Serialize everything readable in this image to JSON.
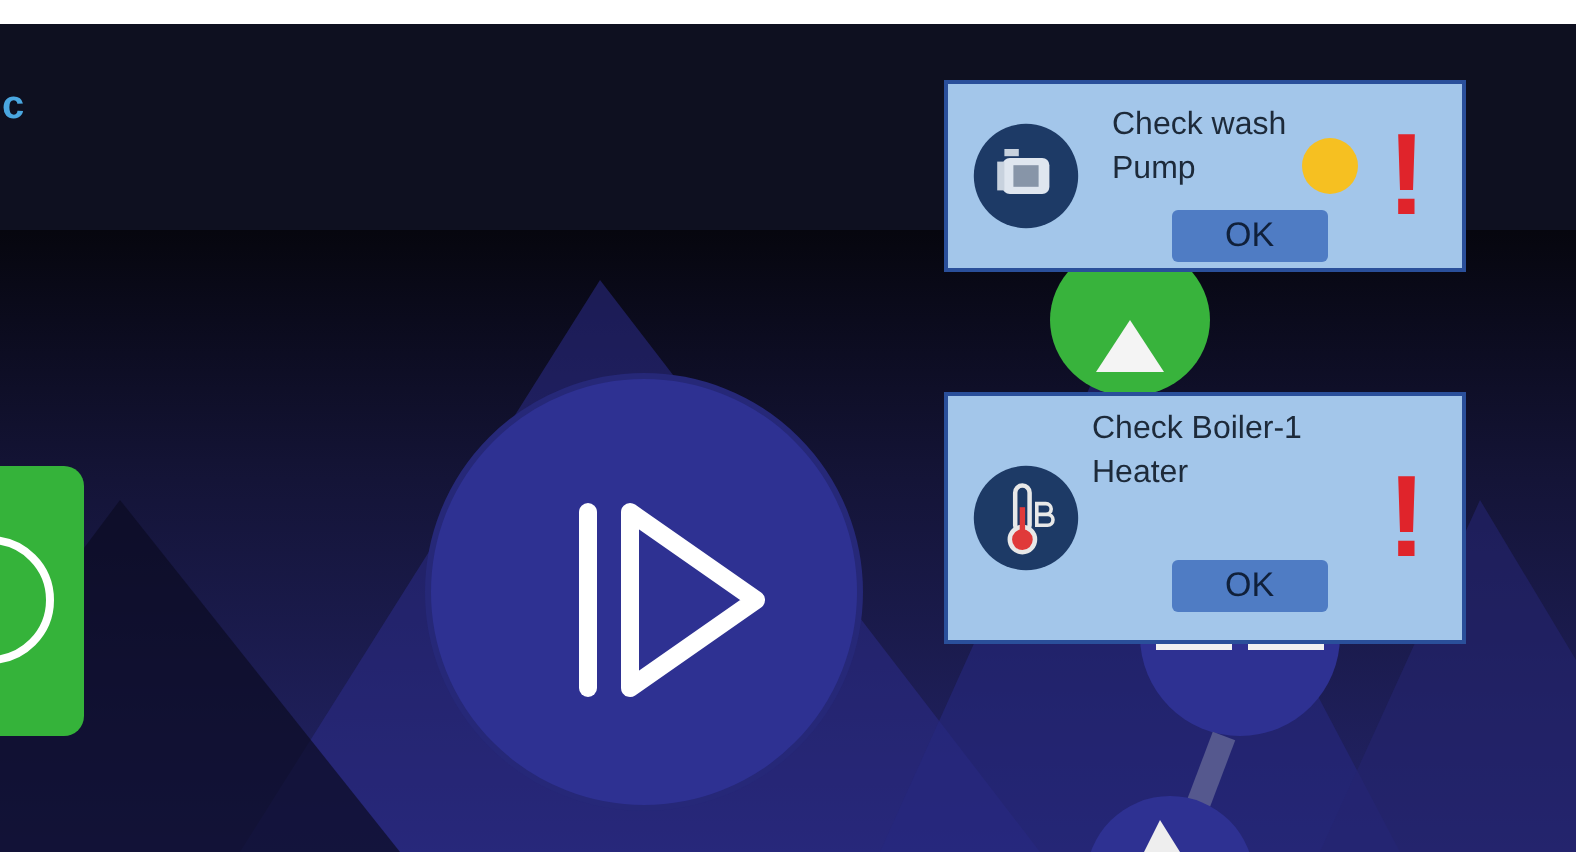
{
  "header": {
    "logo_text": "c"
  },
  "alerts": [
    {
      "kind": "pump",
      "lines": [
        "Check wash",
        "Pump"
      ],
      "indicator": {
        "color": "#f6c021"
      },
      "mark": "!",
      "button": "OK"
    },
    {
      "kind": "thermometer",
      "lines": [
        "Check Boiler-1",
        "Heater"
      ],
      "mark": "!",
      "button": "OK"
    }
  ]
}
